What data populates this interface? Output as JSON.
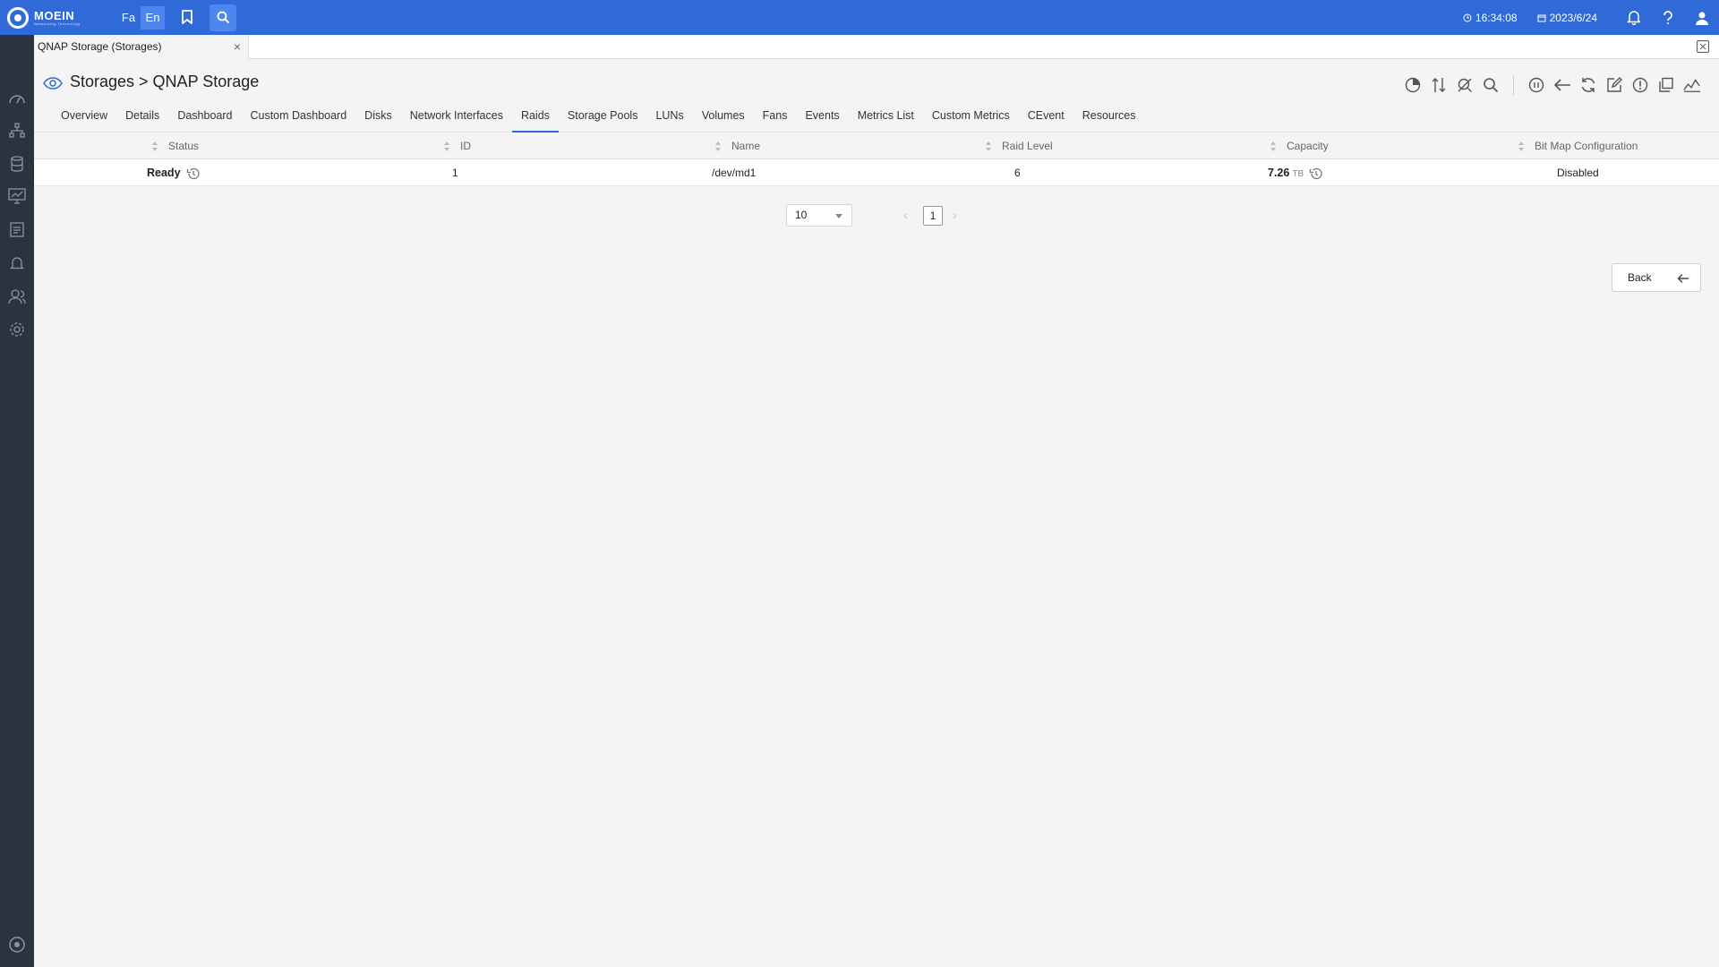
{
  "topbar": {
    "logo_text": "MOEIN",
    "logo_sub": "Networking Technology",
    "lang_fa": "Fa",
    "lang_en": "En",
    "time": "16:34:08",
    "date": "2023/6/24",
    "icons": [
      "bookmark-icon",
      "search-icon",
      "clock-icon",
      "calendar-icon",
      "bell-icon",
      "help-icon",
      "user-icon"
    ]
  },
  "sidebar": {
    "items": [
      "dashboard-icon",
      "topology-icon",
      "database-icon",
      "monitor-icon",
      "report-icon",
      "alarm-icon",
      "users-icon",
      "settings-icon",
      "logo-icon"
    ]
  },
  "doc_tab": {
    "label": "QNAP Storage (Storages)",
    "close": "×"
  },
  "header": {
    "title": "Storages > QNAP Storage"
  },
  "subtabs": [
    {
      "label": "Overview"
    },
    {
      "label": "Details"
    },
    {
      "label": "Dashboard"
    },
    {
      "label": "Custom Dashboard"
    },
    {
      "label": "Disks"
    },
    {
      "label": "Network Interfaces"
    },
    {
      "label": "Raids",
      "active": true
    },
    {
      "label": "Storage Pools"
    },
    {
      "label": "LUNs"
    },
    {
      "label": "Volumes"
    },
    {
      "label": "Fans"
    },
    {
      "label": "Events"
    },
    {
      "label": "Metrics List"
    },
    {
      "label": "Custom Metrics"
    },
    {
      "label": "CEvent"
    },
    {
      "label": "Resources"
    }
  ],
  "table": {
    "columns": [
      "Status",
      "ID",
      "Name",
      "Raid Level",
      "Capacity",
      "Bit Map Configuration"
    ],
    "rows": [
      {
        "status": "Ready",
        "id": "1",
        "name": "/dev/md1",
        "raid_level": "6",
        "capacity": "7.26",
        "capacity_unit": "TB",
        "bitmap": "Disabled"
      }
    ]
  },
  "pagination": {
    "page_size": "10",
    "current_page": "1",
    "prev": "‹",
    "next": "›"
  },
  "back_button": {
    "label": "Back"
  },
  "colors": {
    "topbar": "#2f6ad8",
    "sidebar": "#2a3340",
    "accent": "#2f6ad8"
  }
}
